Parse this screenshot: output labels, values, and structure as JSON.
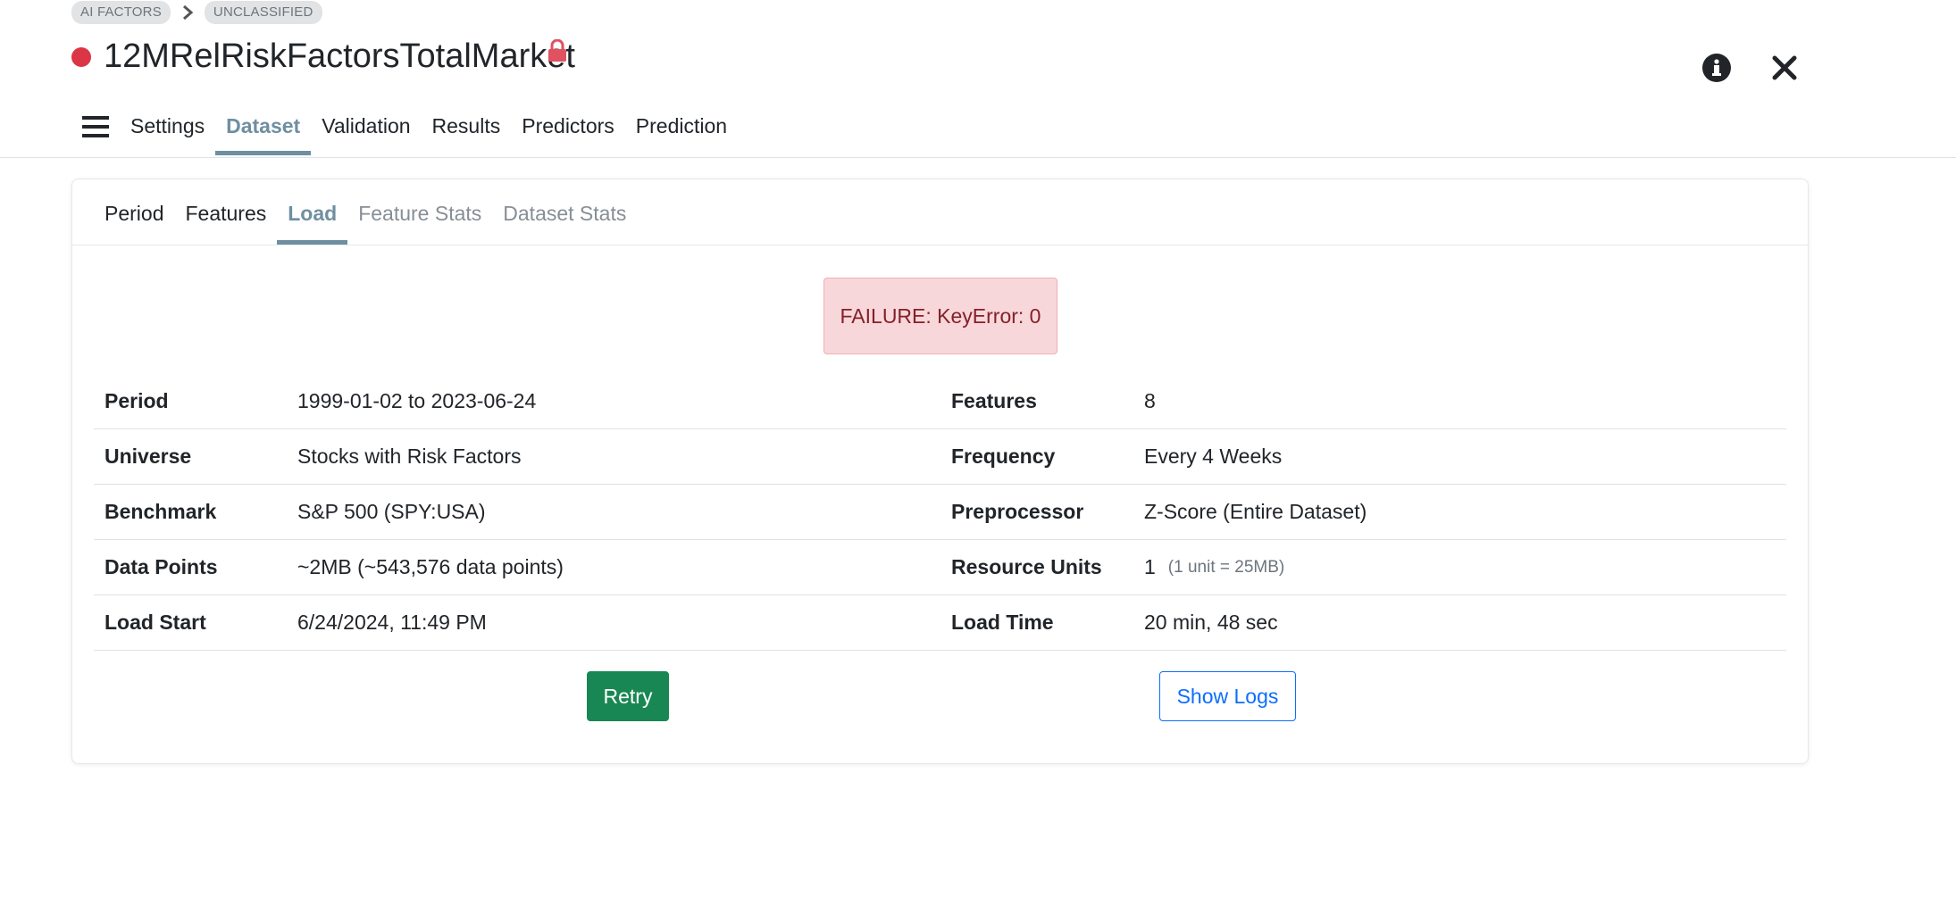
{
  "breadcrumb": [
    "AI FACTORS",
    "UNCLASSIFIED"
  ],
  "header": {
    "title": "12MRelRiskFactorsTotalMarket",
    "status_color": "#dc3545"
  },
  "main_tabs": [
    {
      "label": "Settings",
      "active": false
    },
    {
      "label": "Dataset",
      "active": true
    },
    {
      "label": "Validation",
      "active": false
    },
    {
      "label": "Results",
      "active": false
    },
    {
      "label": "Predictors",
      "active": false
    },
    {
      "label": "Prediction",
      "active": false
    }
  ],
  "sub_tabs": [
    {
      "label": "Period",
      "state": "normal"
    },
    {
      "label": "Features",
      "state": "normal"
    },
    {
      "label": "Load",
      "state": "active"
    },
    {
      "label": "Feature Stats",
      "state": "disabled"
    },
    {
      "label": "Dataset Stats",
      "state": "disabled"
    }
  ],
  "alert": {
    "text": "FAILURE: KeyError: 0"
  },
  "info": [
    {
      "l1": "Period",
      "v1": "1999-01-02 to 2023-06-24",
      "l2": "Features",
      "v2": "8"
    },
    {
      "l1": "Universe",
      "v1": "Stocks with Risk Factors",
      "l2": "Frequency",
      "v2": "Every 4 Weeks"
    },
    {
      "l1": "Benchmark",
      "v1": "S&P 500 (SPY:USA)",
      "l2": "Preprocessor",
      "v2": "Z-Score (Entire Dataset)"
    },
    {
      "l1": "Data Points",
      "v1": "~2MB (~543,576 data points)",
      "l2": "Resource Units",
      "v2": "1",
      "note2": "(1 unit = 25MB)"
    },
    {
      "l1": "Load Start",
      "v1": "6/24/2024, 11:49 PM",
      "l2": "Load Time",
      "v2": "20 min, 48 sec"
    }
  ],
  "buttons": {
    "retry": "Retry",
    "show_logs": "Show Logs"
  },
  "icons": {
    "lock": "lock-icon",
    "info": "info-circle-icon",
    "close": "close-icon",
    "menu": "hamburger-menu-icon",
    "chevron": "chevron-right-icon"
  },
  "colors": {
    "accent": "#6f8fa0",
    "success": "#198754",
    "primary": "#0d6efd",
    "danger": "#dc3545",
    "lock": "#e05260"
  }
}
